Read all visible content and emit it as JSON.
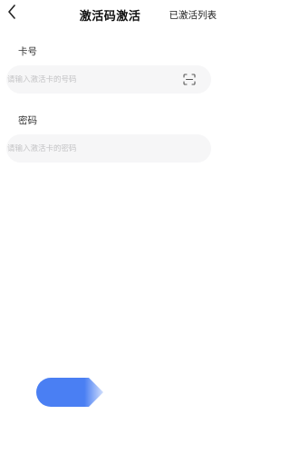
{
  "header": {
    "back_icon": "chevron-left-icon",
    "title": "激活码激活",
    "action_label": "已激活列表"
  },
  "card_number": {
    "label": "卡号",
    "value": "",
    "placeholder": "请输入激活卡的号码",
    "scan_icon": "scan-icon"
  },
  "password": {
    "label": "密码",
    "value": "",
    "placeholder": "请输入激活卡的密码"
  },
  "submit": {
    "label": "",
    "color": "#4a7ff3"
  },
  "colors": {
    "background": "#ffffff",
    "field_background": "#f6f6f7",
    "placeholder": "#c4c4c6",
    "accent": "#4a7ff3"
  }
}
